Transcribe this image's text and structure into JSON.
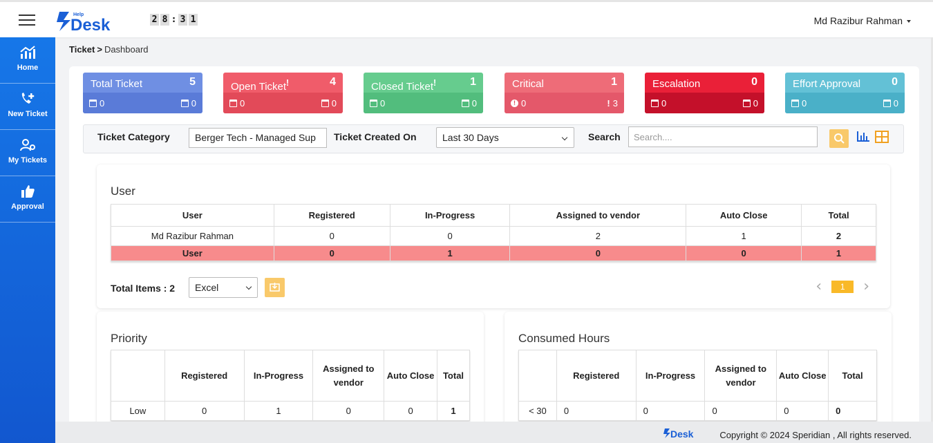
{
  "header": {
    "logo_help": "Help",
    "logo_desk": "Desk",
    "clock_digits": [
      "2",
      "8",
      ":",
      "3",
      "1"
    ],
    "user_name": "Md Razibur Rahman"
  },
  "sidebar": {
    "items": [
      {
        "label": "Home",
        "icon": "chart-icon"
      },
      {
        "label": "New Ticket",
        "icon": "phone-plus-icon"
      },
      {
        "label": "My Tickets",
        "icon": "users-gear-icon"
      },
      {
        "label": "Approval",
        "icon": "thumbs-up-icon"
      }
    ]
  },
  "breadcrumb": {
    "root": "Ticket",
    "sep": ">",
    "current": "Dashboard"
  },
  "cards": [
    {
      "title": "Total Ticket",
      "count": "5",
      "left": "0",
      "right": "0",
      "color": "#6f8fe3",
      "bar": "#5a7bd8"
    },
    {
      "title": "Open Ticket",
      "mark": "!",
      "count": "4",
      "left": "0",
      "right": "0",
      "color": "#f05c6a",
      "bar": "#e24a59"
    },
    {
      "title": "Closed Ticket",
      "mark": "!",
      "count": "1",
      "left": "0",
      "right": "0",
      "color": "#66cc8e",
      "bar": "#52bd7d"
    },
    {
      "title": "Critical",
      "count": "1",
      "left": "0",
      "right": "3",
      "color": "#ee6c78",
      "bar": "#e4586a"
    },
    {
      "title": "Escalation",
      "count": "0",
      "left": "0",
      "right": "0",
      "color": "#ea2038",
      "bar": "#c4102a"
    },
    {
      "title": "Effort Approval",
      "count": "0",
      "left": "0",
      "right": "0",
      "color": "#63c1d6",
      "bar": "#4ab0c8"
    }
  ],
  "filters": {
    "category_label": "Ticket Category",
    "category_value": "Berger Tech - Managed Sup",
    "created_label": "Ticket Created On",
    "created_value": "Last 30 Days",
    "search_label": "Search",
    "search_placeholder": "Search...."
  },
  "user_table": {
    "title": "User",
    "headers": [
      "User",
      "Registered",
      "In-Progress",
      "Assigned to vendor",
      "Auto Close",
      "Total"
    ],
    "rows": [
      [
        "Md Razibur Rahman",
        "0",
        "0",
        "2",
        "1",
        "2"
      ]
    ],
    "total_row": [
      "User",
      "0",
      "1",
      "0",
      "0",
      "1"
    ],
    "total_items_label": "Total Items : 2",
    "export_value": "Excel",
    "page": "1"
  },
  "priority_table": {
    "title": "Priority",
    "headers": [
      "",
      "Registered",
      "In-Progress",
      "Assigned to vendor",
      "Auto Close",
      "Total"
    ],
    "rows": [
      [
        "Low",
        "0",
        "1",
        "0",
        "0",
        "1"
      ]
    ]
  },
  "hours_table": {
    "title": "Consumed Hours",
    "headers": [
      "",
      "Registered",
      "In-Progress",
      "Assigned to vendor",
      "Auto Close",
      "Total"
    ],
    "rows": [
      [
        "< 30",
        "0",
        "0",
        "0",
        "0",
        "0"
      ]
    ]
  },
  "footer": {
    "logo_desk": "Desk",
    "copyright": "Copyright © 2024 Speridian , All rights reserved."
  }
}
